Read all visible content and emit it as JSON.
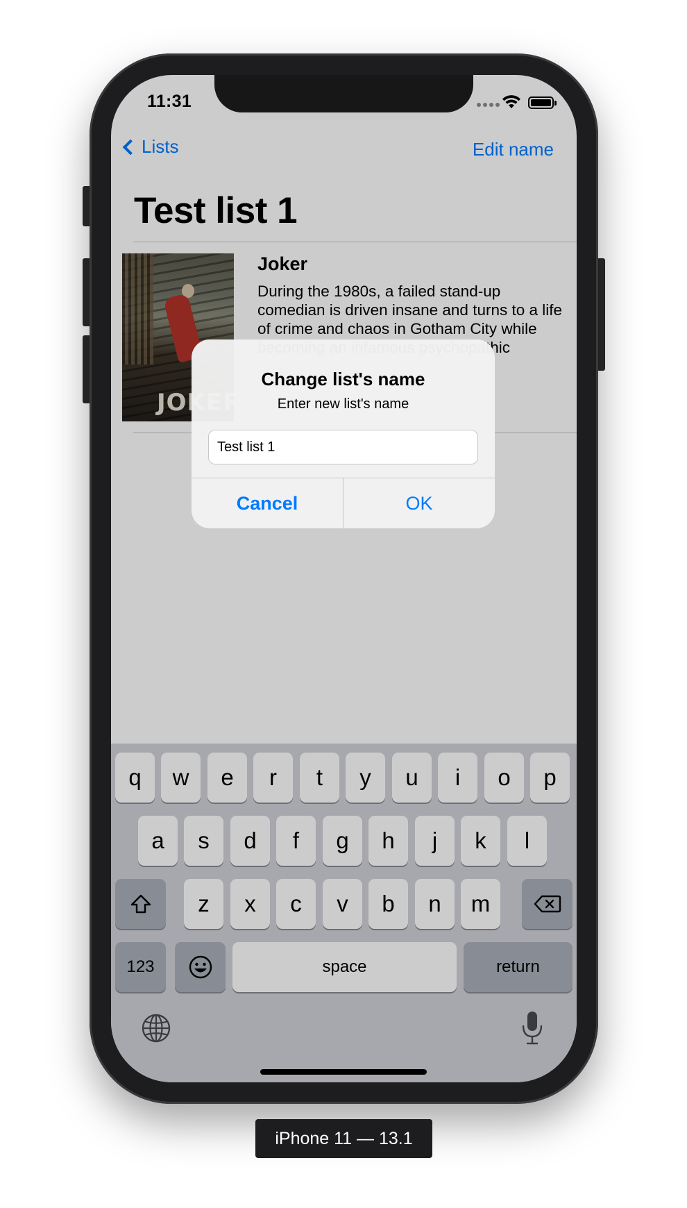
{
  "status_bar": {
    "time": "11:31"
  },
  "nav": {
    "back_label": "Lists",
    "edit_label": "Edit name",
    "title": "Test list 1"
  },
  "list": {
    "items": [
      {
        "title": "Joker",
        "description": "During the 1980s, a failed stand-up comedian is driven insane and turns to a life of crime and chaos in Gotham City while becoming an infamous psychopathic",
        "poster_text": "JOKER"
      }
    ]
  },
  "alert": {
    "title": "Change list's name",
    "message": "Enter new list's name",
    "input_value": "Test list 1",
    "cancel_label": "Cancel",
    "ok_label": "OK"
  },
  "keyboard": {
    "row1": [
      "q",
      "w",
      "e",
      "r",
      "t",
      "y",
      "u",
      "i",
      "o",
      "p"
    ],
    "row2": [
      "a",
      "s",
      "d",
      "f",
      "g",
      "h",
      "j",
      "k",
      "l"
    ],
    "row3": [
      "z",
      "x",
      "c",
      "v",
      "b",
      "n",
      "m"
    ],
    "numbers_label": "123",
    "space_label": "space",
    "return_label": "return",
    "shift_icon": "shift-icon",
    "delete_icon": "delete-icon",
    "emoji_icon": "emoji-icon",
    "globe_icon": "globe-icon",
    "mic_icon": "microphone-icon"
  },
  "device_label": "iPhone 11 — 13.1",
  "colors": {
    "accent": "#007aff",
    "keyboard_bg": "#d1d3d9",
    "special_key": "#abb0bb"
  }
}
